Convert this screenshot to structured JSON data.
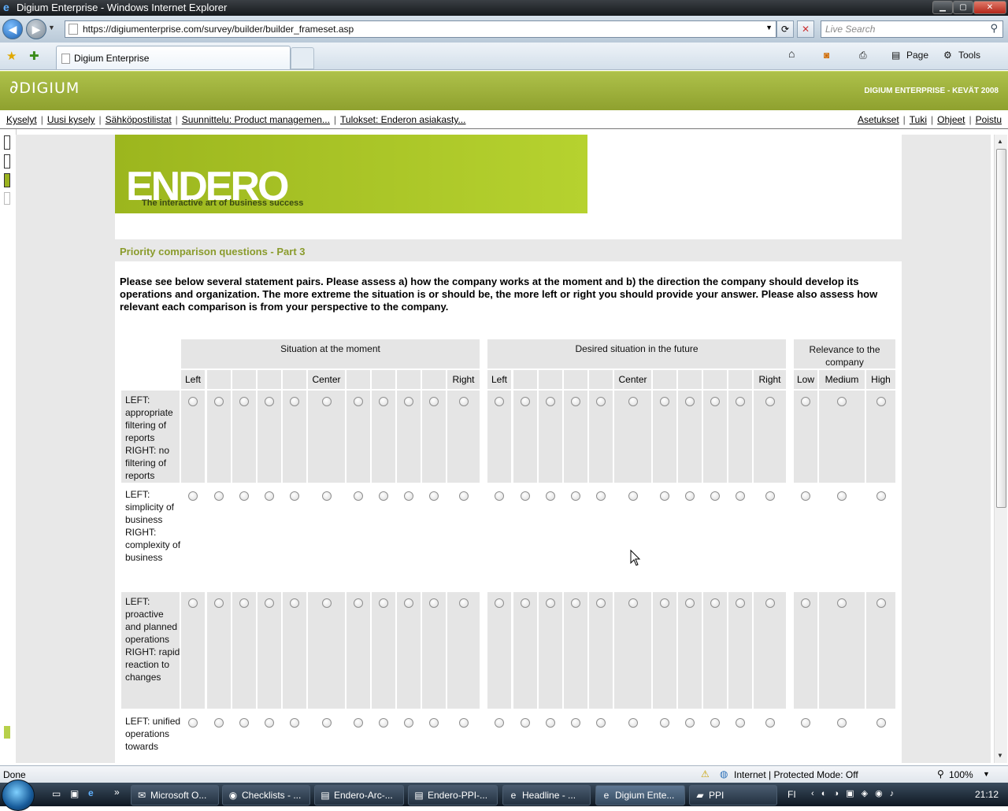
{
  "window": {
    "title": "Digium Enterprise - Windows Internet Explorer",
    "ie_icon": "ie-logo-icon",
    "minimize_glyph": "▁",
    "maximize_glyph": "▢",
    "close_glyph": "✕"
  },
  "browser": {
    "url": "https://digiumenterprise.com/survey/builder/builder_frameset.asp",
    "search_placeholder": "Live Search",
    "tab_title": "Digium Enterprise",
    "commands": {
      "page": "Page",
      "tools": "Tools"
    }
  },
  "app": {
    "logo_text": "DIGIUM",
    "header_title": "DIGIUM ENTERPRISE - KEVÄT 2008",
    "menu_left": [
      "Kyselyt",
      "Uusi kysely",
      "Sähköpostilistat",
      "Suunnittelu: Product managemen...",
      "Tulokset: Enderon asiakasty..."
    ],
    "menu_right": [
      "Asetukset",
      "Tuki",
      "Ohjeet",
      "Poistu"
    ]
  },
  "survey": {
    "banner_brand": "ENDERO",
    "banner_tagline": "The interactive art of business success",
    "section_title": "Priority comparison questions - Part 3",
    "instructions": "Please see below several statement pairs. Please assess a) how the company works at the moment and b) the direction the company should develop its operations and organization. The more extreme the situation is or should be, the more left or right you should provide your answer. Please also assess how relevant each comparison is from your perspective to the company.",
    "groups": {
      "current": "Situation at the moment",
      "future": "Desired situation in the future",
      "relevance": "Relevance to the company"
    },
    "scale_labels": {
      "left": "Left",
      "center": "Center",
      "right": "Right"
    },
    "relevance_labels": [
      "Low",
      "Medium",
      "High"
    ],
    "rows": [
      {
        "label": "LEFT: appropriate filtering of reports RIGHT: no filtering of reports"
      },
      {
        "label": "LEFT: simplicity of business RIGHT: complexity of business"
      },
      {
        "label": "LEFT: proactive and planned operations RIGHT: rapid reaction to changes"
      },
      {
        "label": "LEFT: unified operations towards"
      }
    ]
  },
  "status": {
    "text": "Done",
    "zone": "Internet | Protected Mode: Off",
    "zoom": "100%"
  },
  "taskbar": {
    "items": [
      {
        "label": "Microsoft O...",
        "icon": "outlook-icon"
      },
      {
        "label": "Checklists - ...",
        "icon": "firefox-icon"
      },
      {
        "label": "Endero-Arc-...",
        "icon": "pdf-icon"
      },
      {
        "label": "Endero-PPI-...",
        "icon": "pdf-icon"
      },
      {
        "label": "Headline - ...",
        "icon": "ie-icon"
      },
      {
        "label": "Digium Ente...",
        "icon": "ie-icon"
      },
      {
        "label": "PPI",
        "icon": "folder-icon"
      }
    ],
    "language": "FI",
    "clock": "21:12"
  }
}
